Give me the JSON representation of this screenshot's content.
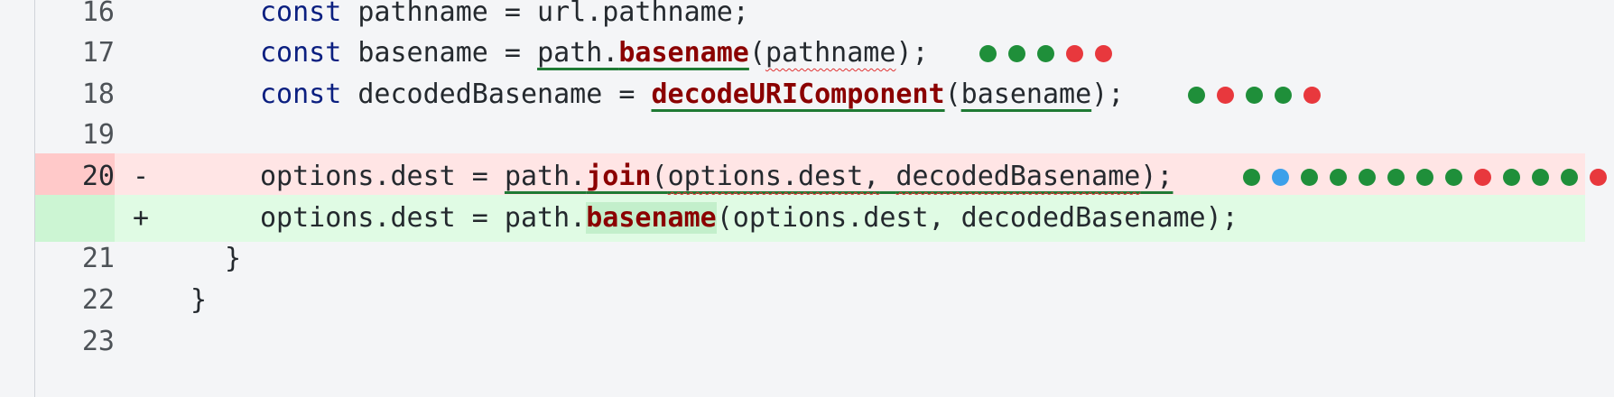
{
  "colors": {
    "good": "#1f8f3a",
    "bad": "#e8383d",
    "neutral": "#3ca0ea"
  },
  "lines": [
    {
      "no": "16",
      "marker": "",
      "tokens": [
        [
          "kw",
          "const"
        ],
        [
          "t",
          " pathname = url.pathname;"
        ]
      ]
    },
    {
      "no": "17",
      "marker": "",
      "tokens": [
        [
          "kw",
          "const"
        ],
        [
          "t",
          " basename = "
        ],
        [
          "t",
          "path."
        ],
        [
          "fn",
          "basename"
        ],
        [
          "t",
          "("
        ],
        [
          "t",
          "pathname"
        ],
        [
          "t",
          ");"
        ]
      ],
      "dots": [
        "good",
        "good",
        "good",
        "bad",
        "bad"
      ]
    },
    {
      "no": "18",
      "marker": "",
      "tokens": [
        [
          "kw",
          "const"
        ],
        [
          "t",
          " decodedBasename = "
        ],
        [
          "fn",
          "decodeURIComponent"
        ],
        [
          "t",
          "("
        ],
        [
          "t",
          "basename"
        ],
        [
          "t",
          ");"
        ]
      ],
      "dots": [
        "good",
        "bad",
        "good",
        "good",
        "bad"
      ]
    },
    {
      "no": "19",
      "marker": "",
      "tokens": []
    },
    {
      "no": "20",
      "marker": "-",
      "tokens": [
        [
          "t",
          "options.dest = "
        ],
        [
          "t",
          "path."
        ],
        [
          "fn",
          "join"
        ],
        [
          "t",
          "("
        ],
        [
          "t",
          "options.dest,"
        ],
        [
          "t",
          " "
        ],
        [
          "t",
          "decodedBasename"
        ],
        [
          "t",
          ");"
        ]
      ],
      "dots": [
        "good",
        "neutral",
        "good",
        "good",
        "good",
        "good",
        "good",
        "good",
        "bad",
        "good",
        "good",
        "good",
        "bad"
      ]
    },
    {
      "no": "",
      "marker": "+",
      "tokens": [
        [
          "t",
          "options.dest = path."
        ],
        [
          "fn",
          "basename"
        ],
        [
          "t",
          "(options.dest, decodedBasename);"
        ]
      ]
    },
    {
      "no": "21",
      "marker": "",
      "tokens": [
        [
          "t",
          "}"
        ]
      ]
    },
    {
      "no": "22",
      "marker": "",
      "tokens": [
        [
          "t",
          "}"
        ]
      ]
    },
    {
      "no": "23",
      "marker": "",
      "tokens": []
    }
  ]
}
